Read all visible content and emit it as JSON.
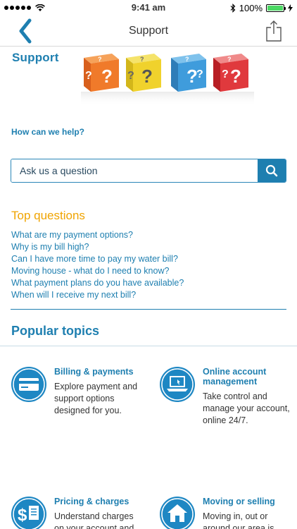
{
  "status_bar": {
    "time": "9:41 am",
    "battery": "100%",
    "battery_level": 1.0
  },
  "nav": {
    "title": "Support",
    "back_icon": "chevron-left-icon",
    "share_icon": "share-icon"
  },
  "header": {
    "heading": "Support",
    "image": "question-mark-dice"
  },
  "help": {
    "question": "How can we help?"
  },
  "search": {
    "placeholder": "Ask us a question",
    "button_icon": "search-icon"
  },
  "top_questions": {
    "title": "Top questions",
    "items": [
      "What are my payment options?",
      "Why is my bill high?",
      "Can I have more time to pay my water bill?",
      "Moving house - what do I need to know?",
      "What payment plans do you have available?",
      "When will I receive my next bill?"
    ]
  },
  "popular_topics": {
    "title": "Popular topics",
    "items": [
      {
        "title": "Billing & payments",
        "desc": "Explore payment and support options designed for you.",
        "icon": "credit-card-icon"
      },
      {
        "title": "Online account management",
        "desc": "Take control and manage your account, online 24/7.",
        "icon": "laptop-icon"
      },
      {
        "title": "Pricing & charges",
        "desc": "Understand charges on your account and",
        "icon": "dollar-document-icon"
      },
      {
        "title": "Moving or selling",
        "desc": "Moving in, out or around our area is",
        "icon": "house-icon"
      }
    ]
  },
  "colors": {
    "brand_blue": "#1e7fb0",
    "accent_orange": "#f0a400",
    "battery_green": "#4cd964"
  }
}
